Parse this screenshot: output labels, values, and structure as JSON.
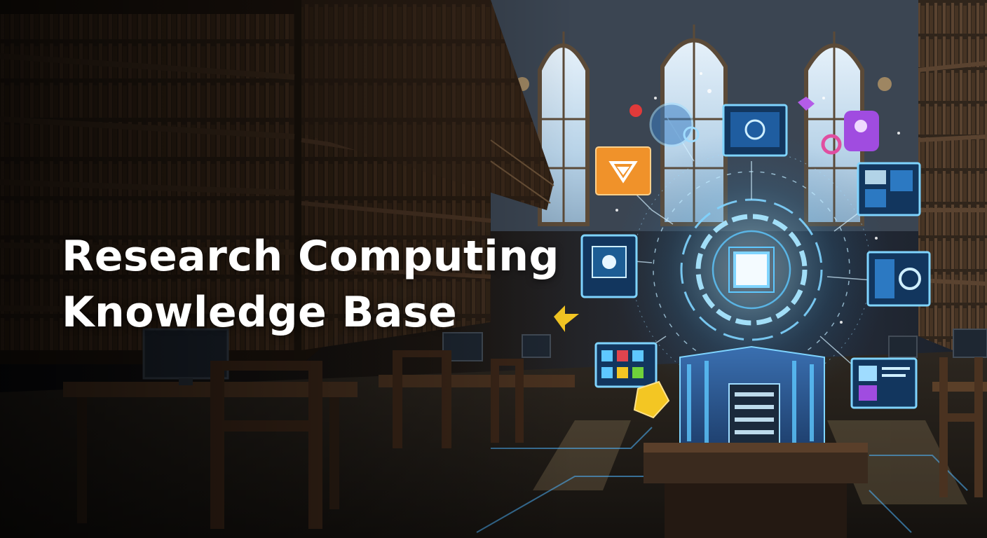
{
  "hero": {
    "title_line_1": "Research Computing",
    "title_line_2": "Knowledge Base"
  },
  "palette": {
    "background": "#0e1116",
    "title_text": "#ffffff",
    "wood_dark": "#2a1c12",
    "wood_mid": "#4a3220",
    "window_light": "#cfe3f2",
    "hologram_blue": "#5ec8ff",
    "panel_fill": "#12365e",
    "icon_orange": "#f0922a",
    "icon_purple": "#a04ce0",
    "icon_yellow": "#f3c623"
  }
}
